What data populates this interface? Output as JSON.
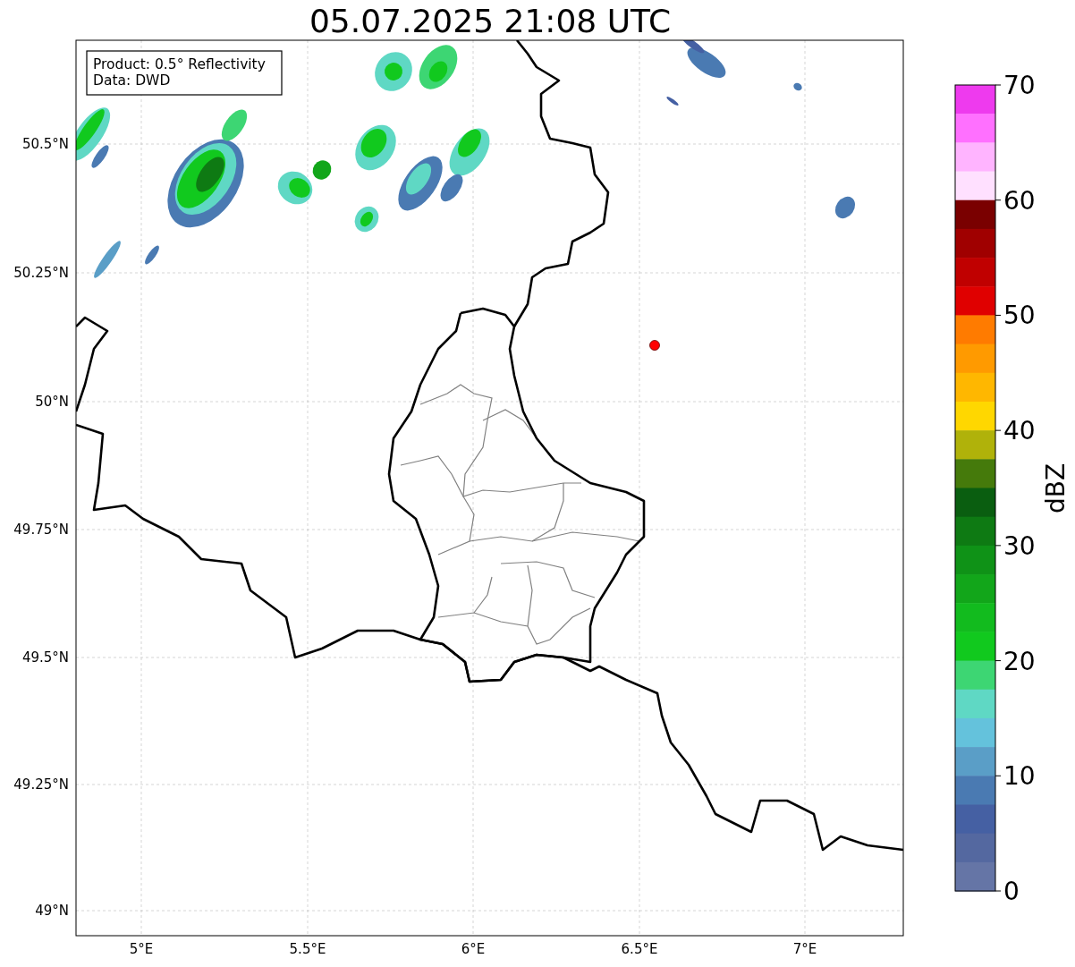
{
  "title": "05.07.2025 21:08 UTC",
  "info_box": [
    "Product: 0.5° Reflectivity",
    "Data: DWD"
  ],
  "map": {
    "xticks": [
      "5°E",
      "5.5°E",
      "6°E",
      "6.5°E",
      "7°E"
    ],
    "yticks": [
      "50.5°N",
      "50.25°N",
      "50°N",
      "49.75°N",
      "49.5°N",
      "49.25°N",
      "49°N"
    ]
  },
  "colorbar": {
    "label": "dBZ",
    "ticks": [
      "70",
      "60",
      "50",
      "40",
      "30",
      "20",
      "10",
      "0"
    ],
    "bins": [
      {
        "color": "#ee3aee"
      },
      {
        "color": "#ff70ff"
      },
      {
        "color": "#ffb4ff"
      },
      {
        "color": "#ffe0ff"
      },
      {
        "color": "#7a0000"
      },
      {
        "color": "#a00000"
      },
      {
        "color": "#c00000"
      },
      {
        "color": "#e00000"
      },
      {
        "color": "#ff7b00"
      },
      {
        "color": "#ff9a00"
      },
      {
        "color": "#ffb700"
      },
      {
        "color": "#ffd700"
      },
      {
        "color": "#b0b20a"
      },
      {
        "color": "#457a0b"
      },
      {
        "color": "#0a5e10"
      },
      {
        "color": "#0e7a13"
      },
      {
        "color": "#0f9217"
      },
      {
        "color": "#12a61a"
      },
      {
        "color": "#12bb1e"
      },
      {
        "color": "#11c91e"
      },
      {
        "color": "#3dd673"
      },
      {
        "color": "#5fd8c4"
      },
      {
        "color": "#64c2dc"
      },
      {
        "color": "#5a9ec7"
      },
      {
        "color": "#4a7ab2"
      },
      {
        "color": "#4560a3"
      },
      {
        "color": "#5468a0"
      },
      {
        "color": "#6575a6"
      }
    ]
  }
}
